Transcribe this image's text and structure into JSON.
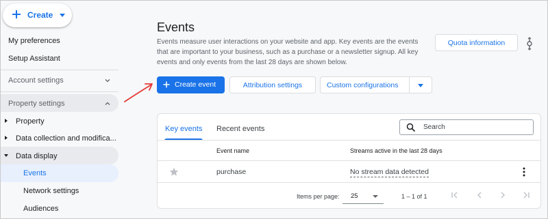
{
  "sidebar": {
    "create_label": "Create",
    "items": [
      {
        "label": "My preferences"
      },
      {
        "label": "Setup Assistant"
      },
      {
        "label": "Account settings"
      },
      {
        "label": "Property settings"
      },
      {
        "label": "Property"
      },
      {
        "label": "Data collection and modifica..."
      },
      {
        "label": "Data display"
      },
      {
        "label": "Events"
      },
      {
        "label": "Network settings"
      },
      {
        "label": "Audiences"
      }
    ]
  },
  "main": {
    "title": "Events",
    "description": "Events measure user interactions on your website and app. Key events are the events that are important to your business, such as a purchase or a newsletter signup. All key events and only events from the last 28 days are shown below.",
    "quota_label": "Quota information",
    "create_event_label": "Create event",
    "attribution_label": "Attribution settings",
    "custom_config_label": "Custom configurations"
  },
  "card": {
    "tabs": [
      {
        "label": "Key events"
      },
      {
        "label": "Recent events"
      }
    ],
    "search_placeholder": "Search",
    "columns": [
      "Event name",
      "Streams active in the last 28 days"
    ],
    "rows": [
      {
        "event_name": "purchase",
        "streams": "No stream data detected"
      }
    ],
    "pager": {
      "items_per_page_label": "Items per page:",
      "items_per_page": "25",
      "range": "1 – 1 of 1"
    }
  },
  "colors": {
    "accent": "#1a73e8",
    "annotation_arrow": "#e53935"
  },
  "icons": [
    "plus-icon",
    "chevron-up-icon",
    "chevron-down-icon",
    "star-icon",
    "search-icon",
    "more-vert-icon",
    "first-page-icon",
    "prev-page-icon",
    "next-page-icon",
    "last-page-icon"
  ]
}
